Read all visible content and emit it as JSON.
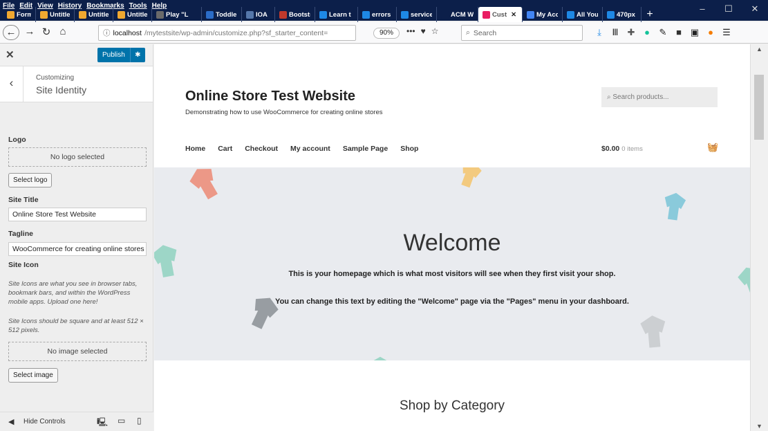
{
  "menu": [
    "File",
    "Edit",
    "View",
    "History",
    "Bookmarks",
    "Tools",
    "Help"
  ],
  "tabs": [
    {
      "label": "Forms",
      "color": "#f0a830"
    },
    {
      "label": "Untitle",
      "color": "#f0a830"
    },
    {
      "label": "Untitle",
      "color": "#f0a830"
    },
    {
      "label": "Untitle",
      "color": "#f0a830"
    },
    {
      "label": "Play \"L",
      "color": "#6a6a6a"
    },
    {
      "label": "Toddle",
      "color": "#2b6cc8"
    },
    {
      "label": "IOA",
      "color": "#5577aa"
    },
    {
      "label": "Bootstr",
      "color": "#c0392b"
    },
    {
      "label": "Learn t",
      "color": "#1e88e5"
    },
    {
      "label": "errors -",
      "color": "#1e88e5"
    },
    {
      "label": "services",
      "color": "#1e88e5"
    },
    {
      "label": "ACM Web",
      "color": "#0c1f4a"
    },
    {
      "label": "Cust",
      "color": "#e91e63",
      "active": true
    },
    {
      "label": "My Acc",
      "color": "#4285f4"
    },
    {
      "label": "All You",
      "color": "#1e88e5"
    },
    {
      "label": "470px",
      "color": "#1e88e5"
    }
  ],
  "nav": {
    "host": "localhost",
    "path": "/mytestsite/wp-admin/customize.php?sf_starter_content=",
    "zoom": "90%",
    "search_placeholder": "Search"
  },
  "customizer": {
    "publish": "Publish",
    "sub": "Customizing",
    "section": "Site Identity",
    "logo_label": "Logo",
    "logo_none": "No logo selected",
    "select_logo": "Select logo",
    "title_label": "Site Title",
    "title_value": "Online Store Test Website",
    "tagline_label": "Tagline",
    "tagline_value": "WooCommerce for creating online stores",
    "icon_label": "Site Icon",
    "icon_desc1": "Site Icons are what you see in browser tabs, bookmark bars, and within the WordPress mobile apps. Upload one here!",
    "icon_desc2": "Site Icons should be square and at least 512 × 512 pixels.",
    "icon_none": "No image selected",
    "select_image": "Select image",
    "hide_controls": "Hide Controls"
  },
  "site": {
    "title": "Online Store Test Website",
    "tagline": "Demonstrating how to use WooCommerce for creating online stores",
    "search_placeholder": "Search products...",
    "menu": [
      "Home",
      "Cart",
      "Checkout",
      "My account",
      "Sample Page",
      "Shop"
    ],
    "cart_total": "$0.00",
    "cart_items": "0 items",
    "welcome": "Welcome",
    "line1": "This is your homepage which is what most visitors will see when they first visit your shop.",
    "line2": "You can change this text by editing the \"Welcome\" page via the \"Pages\" menu in your dashboard.",
    "shop_by": "Shop by Category"
  }
}
